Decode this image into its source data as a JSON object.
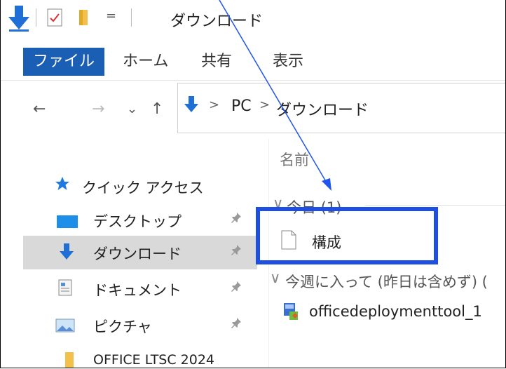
{
  "window": {
    "title": "ダウンロード"
  },
  "quick_access_dropdown": "=",
  "ribbon": {
    "tabs": [
      {
        "label": "ファイル",
        "active": true
      },
      {
        "label": "ホーム"
      },
      {
        "label": "共有"
      },
      {
        "label": "表示"
      }
    ]
  },
  "address": {
    "nav": {
      "back": "←",
      "forward": "→",
      "recent": "⌄",
      "up": "↑"
    },
    "sep1": ">",
    "crumb_pc": "PC",
    "sep2": ">",
    "crumb_folder": "ダウンロード"
  },
  "sidebar": {
    "items": [
      {
        "label": "クイック アクセス",
        "icon": "star-icon"
      },
      {
        "label": "デスクトップ",
        "icon": "desktop-icon",
        "pinned": true
      },
      {
        "label": "ダウンロード",
        "icon": "download-icon",
        "pinned": true,
        "selected": true
      },
      {
        "label": "ドキュメント",
        "icon": "document-icon",
        "pinned": true
      },
      {
        "label": "ピクチャ",
        "icon": "picture-icon",
        "pinned": true
      },
      {
        "label": "OFFICE LTSC 2024",
        "icon": "folder-icon"
      }
    ],
    "pin_glyph": "📌"
  },
  "content": {
    "column_name": "名前",
    "groups": [
      {
        "label": "今日 (1)",
        "chevron": "∨",
        "files": [
          {
            "name": "構成",
            "icon": "blank-file-icon"
          }
        ]
      },
      {
        "label": "今週に入って (昨日は含めず) (",
        "chevron": "∨",
        "files": [
          {
            "name": "officedeploymenttool_1",
            "icon": "installer-icon"
          }
        ]
      }
    ]
  },
  "colors": {
    "accent": "#1a5fb4",
    "highlight": "#1f4fe0",
    "selected_bg": "#d9d9d9"
  }
}
